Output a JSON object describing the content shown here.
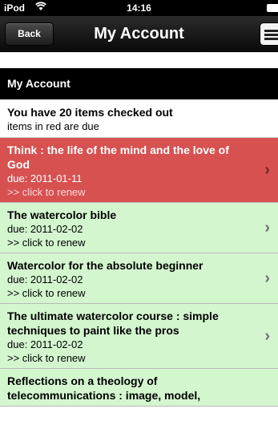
{
  "status_bar": {
    "carrier": "iPod",
    "time": "14:16"
  },
  "nav": {
    "back_label": "Back",
    "title": "My Account"
  },
  "section": {
    "header": "My Account"
  },
  "summary": {
    "title": "You have 20 items checked out",
    "subtitle": "items in red are due"
  },
  "items": [
    {
      "title": "Think : the life of the mind and the love of God",
      "due": "due: 2011-01-11",
      "renew": ">> click to renew",
      "status": "overdue"
    },
    {
      "title": "The watercolor bible",
      "due": "due: 2011-02-02",
      "renew": ">> click to renew",
      "status": "ok"
    },
    {
      "title": "Watercolor for the absolute beginner",
      "due": "due: 2011-02-02",
      "renew": ">> click to renew",
      "status": "ok"
    },
    {
      "title": "The ultimate watercolor course : simple techniques to paint like the pros",
      "due": "due: 2011-02-02",
      "renew": ">> click to renew",
      "status": "ok"
    },
    {
      "title": "Reflections on a theology of telecommunications : image, model,",
      "due": "",
      "renew": "",
      "status": "ok"
    }
  ],
  "colors": {
    "overdue": "#d75151",
    "ok": "#d3f6cf",
    "nav": "#1a1a1a"
  },
  "icons": {
    "wifi": "wifi-icon",
    "battery": "battery-icon",
    "menu": "list-menu-icon",
    "chevron": "chevron-right-icon"
  }
}
